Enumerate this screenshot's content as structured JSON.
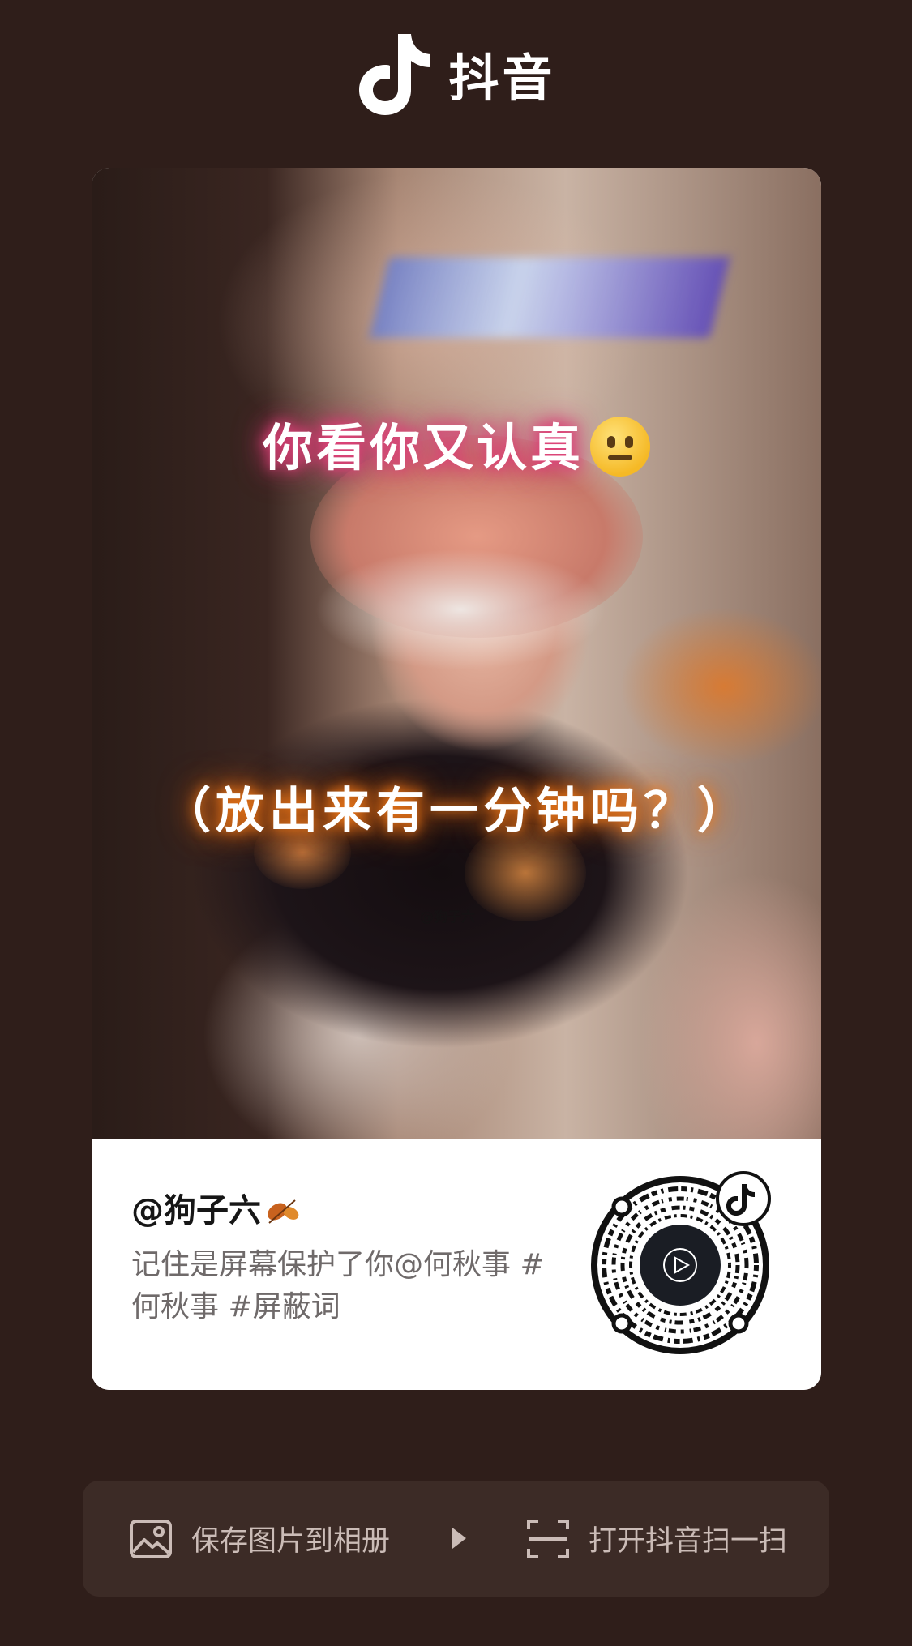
{
  "app": {
    "name": "抖音"
  },
  "video": {
    "caption_top": "你看你又认真",
    "caption_bottom": "（放出来有一分钟吗？）",
    "watermark": "@狗子六"
  },
  "post": {
    "author": "@狗子六",
    "description": "记住是屏幕保护了你@何秋事 #何秋事 #屏蔽词"
  },
  "actions": {
    "save_label": "保存图片到相册",
    "scan_label": "打开抖音扫一扫"
  },
  "colors": {
    "background": "#2f1e1a",
    "action_bar": "#3c2b26",
    "card": "#ffffff"
  }
}
